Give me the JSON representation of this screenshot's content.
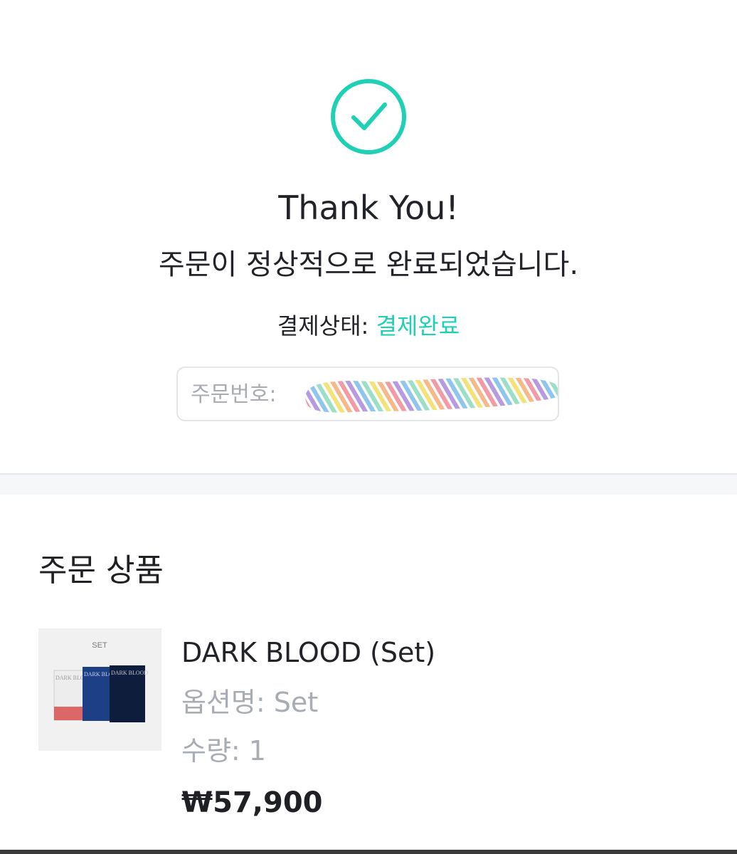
{
  "colors": {
    "accent": "#1fd1b4",
    "text": "#222328",
    "muted": "#a8acb3"
  },
  "success": {
    "icon": "check-circle-icon",
    "title": "Thank You!",
    "message": "주문이 정상적으로 완료되었습니다."
  },
  "payment": {
    "status_label": "결제상태: ",
    "status_value": "결제완료"
  },
  "order": {
    "number_label": "주문번호:",
    "number_redacted": true
  },
  "products_section": {
    "title": "주문 상품",
    "items": [
      {
        "thumb_label": "SET",
        "cover_text": "DARK BLOOD",
        "name": "DARK BLOOD (Set)",
        "option": "옵션명: Set",
        "quantity": "수량: 1",
        "price": "₩57,900"
      }
    ]
  }
}
